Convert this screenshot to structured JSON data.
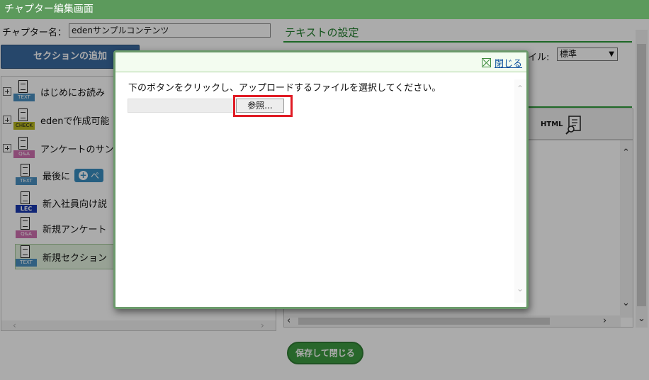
{
  "window": {
    "title": "チャプター編集画面"
  },
  "chapter": {
    "label": "チャプター名：",
    "value": "edenサンプルコンテンツ"
  },
  "sidebar": {
    "add_section_label": "セクションの追加",
    "items": [
      {
        "label": "はじめにお読み",
        "badge": "TEXT"
      },
      {
        "label": "edenで作成可能",
        "badge": "CHECK"
      },
      {
        "label": "アンケートのサン",
        "badge": "Q&A"
      },
      {
        "label": "最後に",
        "badge": "TEXT",
        "pill": "ペ"
      },
      {
        "label": "新入社員向け説",
        "badge": "LEC"
      },
      {
        "label": "新規アンケート",
        "badge": "Q&A"
      },
      {
        "label": "新規セクション",
        "badge": "TEXT"
      }
    ]
  },
  "text_settings": {
    "title": "テキストの設定",
    "style_label": "イル:",
    "style_value": "標準",
    "html_label": "HTML"
  },
  "modal": {
    "close_label": "閉じる",
    "instruction": "下のボタンをクリックし、アップロードするファイルを選択してください。",
    "browse_label": "参照..."
  },
  "footer": {
    "save_close_label": "保存して閉じる"
  },
  "colors": {
    "titlebar": "#5c9a5c",
    "accent_green": "#2e9a3a",
    "add_button": "#3a6aa0",
    "highlight": "#e01b24",
    "save_button": "#3c9a40"
  },
  "icons": [
    "document-text-icon",
    "checklist-icon",
    "qa-icon",
    "lecture-icon",
    "plus-circle-icon",
    "preview-icon",
    "close-icon",
    "expand-icon"
  ]
}
